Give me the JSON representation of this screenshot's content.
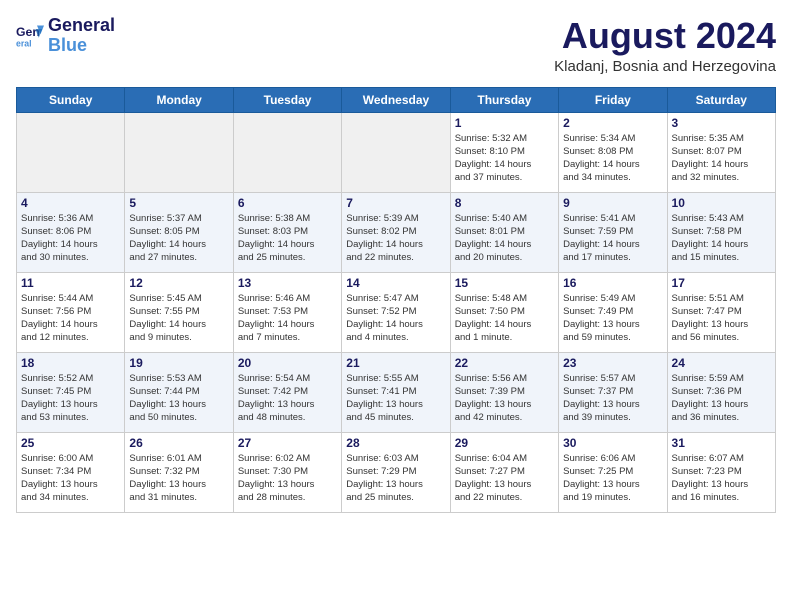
{
  "header": {
    "logo_line1": "General",
    "logo_line2": "Blue",
    "month_year": "August 2024",
    "location": "Kladanj, Bosnia and Herzegovina"
  },
  "weekdays": [
    "Sunday",
    "Monday",
    "Tuesday",
    "Wednesday",
    "Thursday",
    "Friday",
    "Saturday"
  ],
  "weeks": [
    [
      {
        "day": "",
        "info": ""
      },
      {
        "day": "",
        "info": ""
      },
      {
        "day": "",
        "info": ""
      },
      {
        "day": "",
        "info": ""
      },
      {
        "day": "1",
        "info": "Sunrise: 5:32 AM\nSunset: 8:10 PM\nDaylight: 14 hours\nand 37 minutes."
      },
      {
        "day": "2",
        "info": "Sunrise: 5:34 AM\nSunset: 8:08 PM\nDaylight: 14 hours\nand 34 minutes."
      },
      {
        "day": "3",
        "info": "Sunrise: 5:35 AM\nSunset: 8:07 PM\nDaylight: 14 hours\nand 32 minutes."
      }
    ],
    [
      {
        "day": "4",
        "info": "Sunrise: 5:36 AM\nSunset: 8:06 PM\nDaylight: 14 hours\nand 30 minutes."
      },
      {
        "day": "5",
        "info": "Sunrise: 5:37 AM\nSunset: 8:05 PM\nDaylight: 14 hours\nand 27 minutes."
      },
      {
        "day": "6",
        "info": "Sunrise: 5:38 AM\nSunset: 8:03 PM\nDaylight: 14 hours\nand 25 minutes."
      },
      {
        "day": "7",
        "info": "Sunrise: 5:39 AM\nSunset: 8:02 PM\nDaylight: 14 hours\nand 22 minutes."
      },
      {
        "day": "8",
        "info": "Sunrise: 5:40 AM\nSunset: 8:01 PM\nDaylight: 14 hours\nand 20 minutes."
      },
      {
        "day": "9",
        "info": "Sunrise: 5:41 AM\nSunset: 7:59 PM\nDaylight: 14 hours\nand 17 minutes."
      },
      {
        "day": "10",
        "info": "Sunrise: 5:43 AM\nSunset: 7:58 PM\nDaylight: 14 hours\nand 15 minutes."
      }
    ],
    [
      {
        "day": "11",
        "info": "Sunrise: 5:44 AM\nSunset: 7:56 PM\nDaylight: 14 hours\nand 12 minutes."
      },
      {
        "day": "12",
        "info": "Sunrise: 5:45 AM\nSunset: 7:55 PM\nDaylight: 14 hours\nand 9 minutes."
      },
      {
        "day": "13",
        "info": "Sunrise: 5:46 AM\nSunset: 7:53 PM\nDaylight: 14 hours\nand 7 minutes."
      },
      {
        "day": "14",
        "info": "Sunrise: 5:47 AM\nSunset: 7:52 PM\nDaylight: 14 hours\nand 4 minutes."
      },
      {
        "day": "15",
        "info": "Sunrise: 5:48 AM\nSunset: 7:50 PM\nDaylight: 14 hours\nand 1 minute."
      },
      {
        "day": "16",
        "info": "Sunrise: 5:49 AM\nSunset: 7:49 PM\nDaylight: 13 hours\nand 59 minutes."
      },
      {
        "day": "17",
        "info": "Sunrise: 5:51 AM\nSunset: 7:47 PM\nDaylight: 13 hours\nand 56 minutes."
      }
    ],
    [
      {
        "day": "18",
        "info": "Sunrise: 5:52 AM\nSunset: 7:45 PM\nDaylight: 13 hours\nand 53 minutes."
      },
      {
        "day": "19",
        "info": "Sunrise: 5:53 AM\nSunset: 7:44 PM\nDaylight: 13 hours\nand 50 minutes."
      },
      {
        "day": "20",
        "info": "Sunrise: 5:54 AM\nSunset: 7:42 PM\nDaylight: 13 hours\nand 48 minutes."
      },
      {
        "day": "21",
        "info": "Sunrise: 5:55 AM\nSunset: 7:41 PM\nDaylight: 13 hours\nand 45 minutes."
      },
      {
        "day": "22",
        "info": "Sunrise: 5:56 AM\nSunset: 7:39 PM\nDaylight: 13 hours\nand 42 minutes."
      },
      {
        "day": "23",
        "info": "Sunrise: 5:57 AM\nSunset: 7:37 PM\nDaylight: 13 hours\nand 39 minutes."
      },
      {
        "day": "24",
        "info": "Sunrise: 5:59 AM\nSunset: 7:36 PM\nDaylight: 13 hours\nand 36 minutes."
      }
    ],
    [
      {
        "day": "25",
        "info": "Sunrise: 6:00 AM\nSunset: 7:34 PM\nDaylight: 13 hours\nand 34 minutes."
      },
      {
        "day": "26",
        "info": "Sunrise: 6:01 AM\nSunset: 7:32 PM\nDaylight: 13 hours\nand 31 minutes."
      },
      {
        "day": "27",
        "info": "Sunrise: 6:02 AM\nSunset: 7:30 PM\nDaylight: 13 hours\nand 28 minutes."
      },
      {
        "day": "28",
        "info": "Sunrise: 6:03 AM\nSunset: 7:29 PM\nDaylight: 13 hours\nand 25 minutes."
      },
      {
        "day": "29",
        "info": "Sunrise: 6:04 AM\nSunset: 7:27 PM\nDaylight: 13 hours\nand 22 minutes."
      },
      {
        "day": "30",
        "info": "Sunrise: 6:06 AM\nSunset: 7:25 PM\nDaylight: 13 hours\nand 19 minutes."
      },
      {
        "day": "31",
        "info": "Sunrise: 6:07 AM\nSunset: 7:23 PM\nDaylight: 13 hours\nand 16 minutes."
      }
    ]
  ]
}
